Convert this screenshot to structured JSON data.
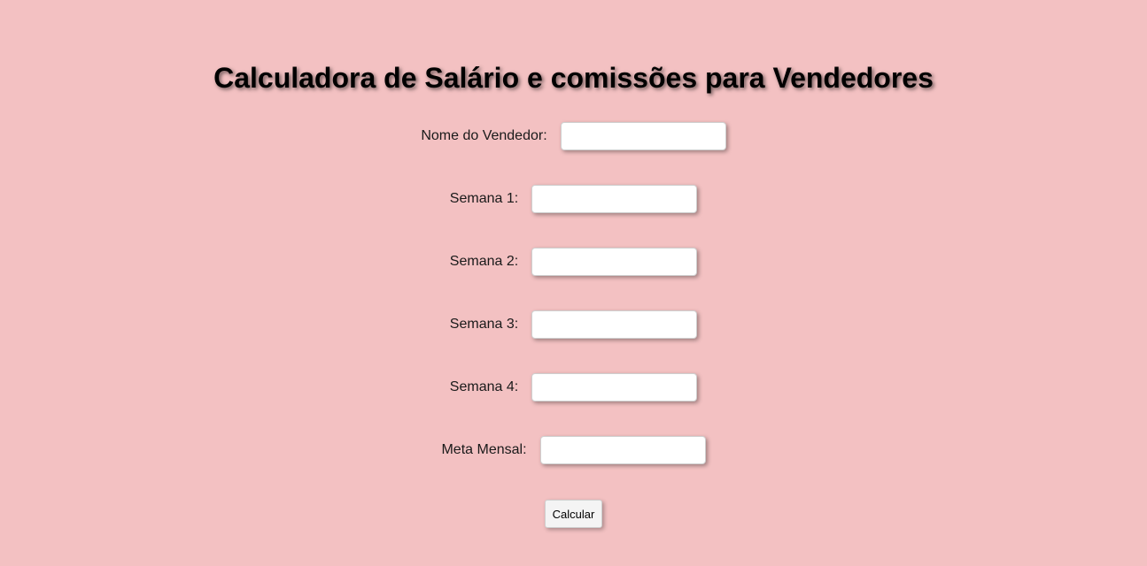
{
  "title": "Calculadora de Salário e comissões para Vendedores",
  "form": {
    "fields": [
      {
        "label": "Nome do Vendedor:",
        "value": ""
      },
      {
        "label": "Semana 1:",
        "value": ""
      },
      {
        "label": "Semana 2:",
        "value": ""
      },
      {
        "label": "Semana 3:",
        "value": ""
      },
      {
        "label": "Semana 4:",
        "value": ""
      },
      {
        "label": "Meta Mensal:",
        "value": ""
      }
    ],
    "submit_label": "Calcular"
  },
  "colors": {
    "background": "#f3c1c2",
    "input_background": "#ffffff"
  }
}
